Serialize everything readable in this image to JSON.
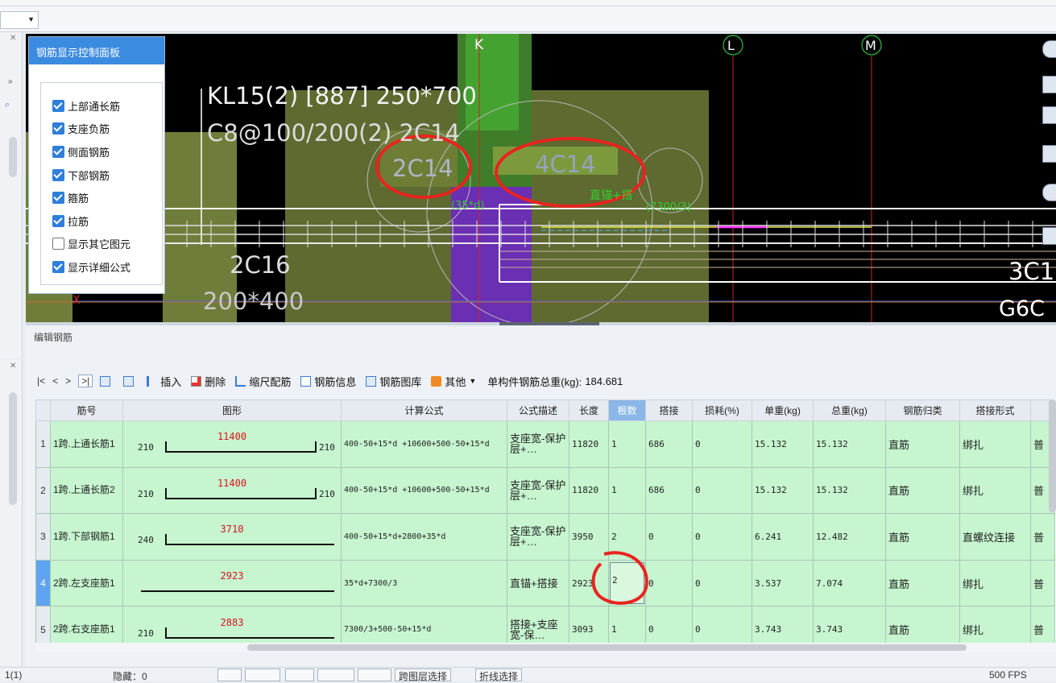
{
  "panel": {
    "title": "钢筋显示控制面板",
    "options": [
      {
        "label": "上部通长筋",
        "checked": true
      },
      {
        "label": "支座负筋",
        "checked": true
      },
      {
        "label": "侧面钢筋",
        "checked": true
      },
      {
        "label": "下部钢筋",
        "checked": true
      },
      {
        "label": "箍筋",
        "checked": true
      },
      {
        "label": "拉筋",
        "checked": true
      },
      {
        "label": "显示其它图元",
        "checked": false
      },
      {
        "label": "显示详细公式",
        "checked": true
      }
    ]
  },
  "canvas": {
    "axis_k": "K",
    "axis_l": "L",
    "axis_m": "M",
    "beam_label_1": "KL15(2) [887] 250*700",
    "beam_label_2": "C8@100/200(2) 2C14",
    "rebar_left": "2C14",
    "rebar_right": "4C14",
    "note_35d": "(35*d)",
    "note_anchor": "直锚+搭",
    "note_l3": "(7300/3)",
    "bottom_label": "2C16",
    "section_label": "200*400",
    "right_label_1": "3C1",
    "right_label_2": "G6C",
    "x_marker": "X"
  },
  "edit": {
    "title": "编辑钢筋",
    "nav": [
      "|<",
      "<",
      ">",
      ">|"
    ],
    "insert": "插入",
    "delete": "删除",
    "scale": "缩尺配筋",
    "info": "钢筋信息",
    "library": "钢筋图库",
    "other": "其他",
    "total_label": "单构件钢筋总重(kg):",
    "total_value": "184.681"
  },
  "table": {
    "headers": [
      "筋号",
      "图形",
      "计算公式",
      "公式描述",
      "长度",
      "根数",
      "搭接",
      "损耗(%)",
      "单重(kg)",
      "总重(kg)",
      "钢筋归类",
      "搭接形式"
    ],
    "rows": [
      {
        "idx": "1",
        "name": "1跨.上通长筋1",
        "shape_left": "210",
        "shape_mid": "11400",
        "shape_right": "210",
        "formula": "400-50+15*d +10600+500-50+15*d",
        "desc": "支座宽-保护层+…",
        "length": "11820",
        "count": "1",
        "lap": "686",
        "loss": "0",
        "unit_w": "15.132",
        "total_w": "15.132",
        "category": "直筋",
        "lap_type": "绑扎",
        "extra": "普"
      },
      {
        "idx": "2",
        "name": "1跨.上通长筋2",
        "shape_left": "210",
        "shape_mid": "11400",
        "shape_right": "210",
        "formula": "400-50+15*d +10600+500-50+15*d",
        "desc": "支座宽-保护层+…",
        "length": "11820",
        "count": "1",
        "lap": "686",
        "loss": "0",
        "unit_w": "15.132",
        "total_w": "15.132",
        "category": "直筋",
        "lap_type": "绑扎",
        "extra": "普"
      },
      {
        "idx": "3",
        "name": "1跨.下部钢筋1",
        "shape_left": "240",
        "shape_mid": "3710",
        "shape_right": "",
        "formula": "400-50+15*d+2800+35*d",
        "desc": "支座宽-保护层+…",
        "length": "3950",
        "count": "2",
        "lap": "0",
        "loss": "0",
        "unit_w": "6.241",
        "total_w": "12.482",
        "category": "直筋",
        "lap_type": "直螺纹连接",
        "extra": "普"
      },
      {
        "idx": "4",
        "name": "2跨.左支座筋1",
        "shape_left": "",
        "shape_mid": "2923",
        "shape_right": "",
        "formula": "35*d+7300/3",
        "desc": "直锚+搭接",
        "length": "2923",
        "count": "2",
        "lap": "0",
        "loss": "0",
        "unit_w": "3.537",
        "total_w": "7.074",
        "category": "直筋",
        "lap_type": "绑扎",
        "extra": "普"
      },
      {
        "idx": "5",
        "name": "2跨.右支座筋1",
        "shape_left": "210",
        "shape_mid": "2883",
        "shape_right": "",
        "formula": "7300/3+500-50+15*d",
        "desc": "搭接+支座宽-保…",
        "length": "3093",
        "count": "1",
        "lap": "0",
        "loss": "0",
        "unit_w": "3.743",
        "total_w": "3.743",
        "category": "直筋",
        "lap_type": "绑扎",
        "extra": "普"
      }
    ]
  },
  "status": {
    "page": "1(1)",
    "hidden": "隐藏：0",
    "btn_layer": "跨图层选择",
    "btn_polyline": "折线选择",
    "fps": "500 FPS"
  },
  "colors": {
    "row_bg": "#c6f5cf",
    "selected_row": "#5fa4ee",
    "panel_header": "#3b8be0",
    "shape_value": "#d8141c",
    "annotation": "#e8241f"
  }
}
